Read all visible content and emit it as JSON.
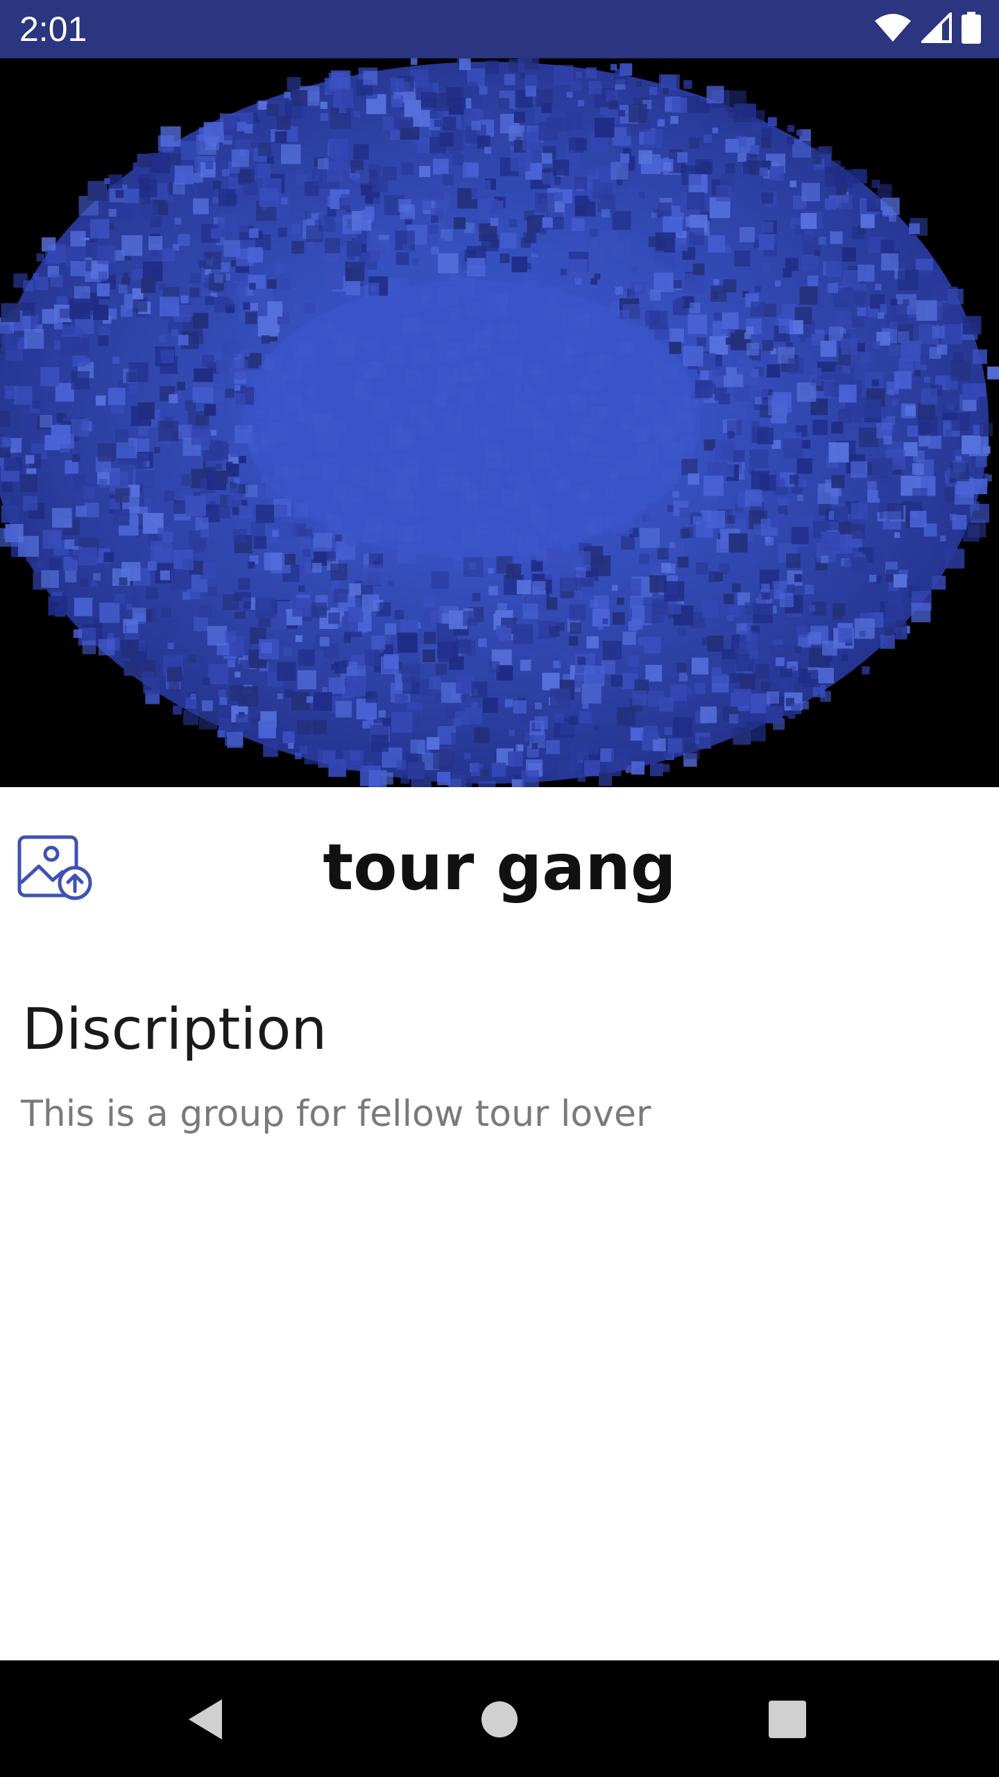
{
  "status_bar": {
    "time": "2:01",
    "icons": [
      "wifi-icon",
      "cellular-signal-icon",
      "battery-icon"
    ],
    "background": "#2c3580"
  },
  "cover_image": {
    "description_icon": "blue-particle-cloud-image",
    "accent": "#3a55c8"
  },
  "header": {
    "upload_icon": "image-upload-icon",
    "title": "tour gang"
  },
  "description": {
    "heading": "Discription",
    "text": "This is a group for fellow tour lover"
  },
  "nav_bar": {
    "back_icon": "back-triangle-icon",
    "home_icon": "home-circle-icon",
    "recents_icon": "recents-square-icon"
  },
  "colors": {
    "accent": "#3f51b5",
    "title_text": "#111111",
    "body_text": "#7a7a7a"
  }
}
